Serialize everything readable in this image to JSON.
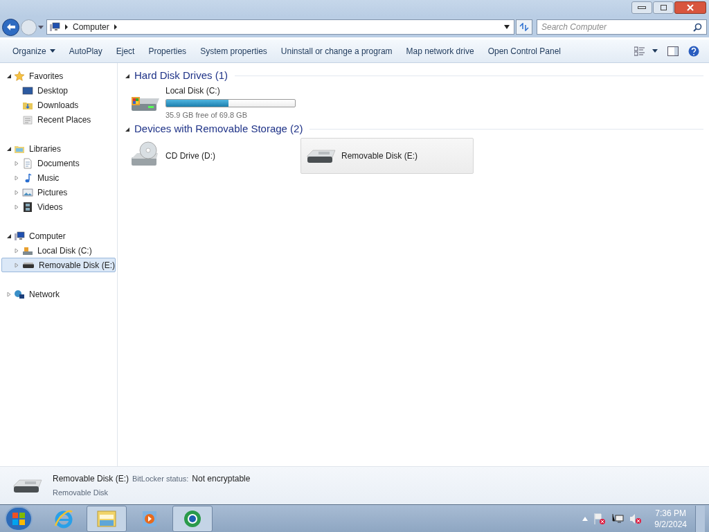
{
  "address": {
    "path": "Computer"
  },
  "search": {
    "placeholder": "Search Computer"
  },
  "toolbar": [
    {
      "label": "Organize",
      "kind": "menu"
    },
    {
      "label": "AutoPlay",
      "kind": "button"
    },
    {
      "label": "Eject",
      "kind": "button"
    },
    {
      "label": "Properties",
      "kind": "button"
    },
    {
      "label": "System properties",
      "kind": "button"
    },
    {
      "label": "Uninstall or change a program",
      "kind": "button"
    },
    {
      "label": "Map network drive",
      "kind": "button"
    },
    {
      "label": "Open Control Panel",
      "kind": "button"
    }
  ],
  "sidebar": {
    "groups": [
      {
        "label": "Favorites",
        "kind": "star",
        "expanded": true,
        "children": [
          {
            "label": "Desktop",
            "kind": "desktop",
            "selected": false
          },
          {
            "label": "Downloads",
            "kind": "downloads",
            "selected": false
          },
          {
            "label": "Recent Places",
            "kind": "recent",
            "selected": false
          }
        ]
      },
      {
        "label": "Libraries",
        "kind": "library",
        "expanded": true,
        "children": [
          {
            "label": "Documents",
            "kind": "documents",
            "selected": false,
            "expanded": false
          },
          {
            "label": "Music",
            "kind": "music",
            "selected": false,
            "expanded": false
          },
          {
            "label": "Pictures",
            "kind": "pictures",
            "selected": false,
            "expanded": false
          },
          {
            "label": "Videos",
            "kind": "videos",
            "selected": false,
            "expanded": false
          }
        ]
      },
      {
        "label": "Computer",
        "kind": "computer",
        "expanded": true,
        "children": [
          {
            "label": "Local Disk (C:)",
            "kind": "hdd",
            "selected": false,
            "expanded": false
          },
          {
            "label": "Removable Disk (E:)",
            "kind": "usb",
            "selected": true,
            "expanded": false
          }
        ]
      },
      {
        "label": "Network",
        "kind": "network",
        "expanded": false
      }
    ]
  },
  "sections": [
    {
      "title": "Hard Disk Drives (1)",
      "expanded": true,
      "items": [
        {
          "name": "Local Disk (C:)",
          "kind": "hdd",
          "level": 0.486,
          "free": "35.9 GB free of 69.8 GB",
          "selected": false
        }
      ]
    },
    {
      "title": "Devices with Removable Storage (2)",
      "expanded": true,
      "items": [
        {
          "name": "CD Drive (D:)",
          "kind": "cd",
          "selected": false
        },
        {
          "name": "Removable Disk (E:)",
          "kind": "usb",
          "selected": true
        }
      ]
    }
  ],
  "details": {
    "name": "Removable Disk (E:)",
    "type": "Removable Disk",
    "field_label": "BitLocker status:",
    "field_value": "Not encryptable"
  },
  "taskbar": {
    "apps": [
      {
        "kind": "ie",
        "open": false
      },
      {
        "kind": "explorer",
        "open": true
      },
      {
        "kind": "media",
        "open": false
      },
      {
        "kind": "globe",
        "open": true
      }
    ],
    "clock": {
      "time": "7:36 PM",
      "date": "9/2/2024"
    }
  }
}
